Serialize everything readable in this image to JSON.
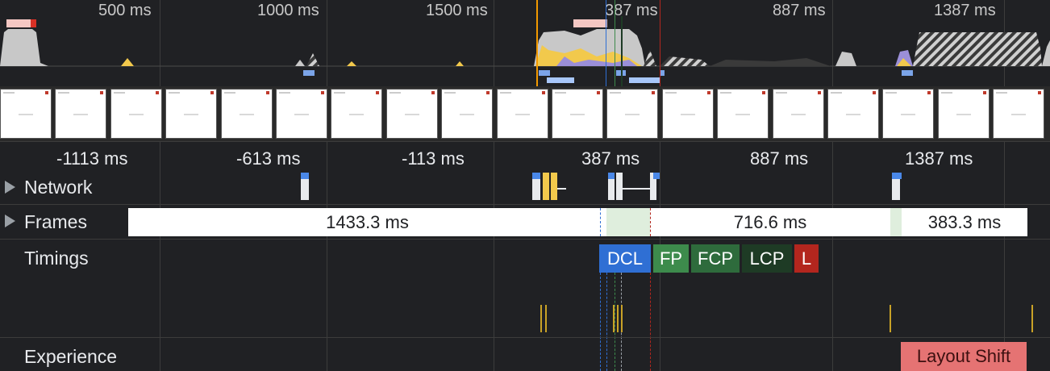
{
  "overview": {
    "ticks": [
      "500 ms",
      "1000 ms",
      "1500 ms",
      "387 ms",
      "887 ms",
      "1387 ms"
    ]
  },
  "ruler": {
    "ticks": [
      "-1113 ms",
      "-613 ms",
      "-113 ms",
      "387 ms",
      "887 ms",
      "1387 ms"
    ]
  },
  "tracks": {
    "network": "Network",
    "frames": "Frames",
    "timings": "Timings",
    "experience": "Experience"
  },
  "frames": {
    "cells": [
      "1433.3 ms",
      "716.6 ms",
      "383.3 ms"
    ]
  },
  "timings": {
    "markers": [
      "DCL",
      "FP",
      "FCP",
      "LCP",
      "L"
    ]
  },
  "experience": {
    "layout_shift": "Layout Shift"
  },
  "colors": {
    "background": "#202124",
    "dcl": "#2f6fd4",
    "fp": "#3d8b4c",
    "fcp": "#2e6b3c",
    "lcp": "#1e3b25",
    "load": "#b3261e",
    "layout_shift": "#e57373",
    "selection_line": "#f29900",
    "scripting": "#f2c94c",
    "rendering": "#9b8fd8"
  }
}
